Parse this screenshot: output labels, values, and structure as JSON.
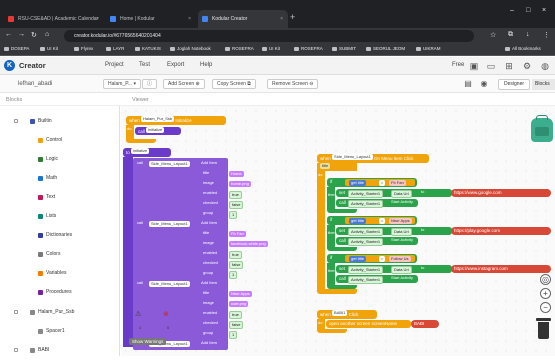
{
  "browser": {
    "tabs": [
      {
        "label": "RSU-CSE&AD | Academic Calendar"
      },
      {
        "label": "Home | Kodular"
      },
      {
        "label": "Kodular Creator"
      }
    ],
    "url": "creator.kodular.io/#6776565640201404",
    "bookmarks": [
      "DOSEPA",
      "UI Kit",
      "Flyrex",
      "LAYR",
      "KATUKIS",
      "Joglah Notebook",
      "ROSEFRA",
      "UI Kit",
      "ROSEFRA",
      "SUBMIT",
      "SEORUL JEOM",
      "UIKRAM",
      "All Bookmarks"
    ]
  },
  "app": {
    "brand": "Creator",
    "menu": [
      "Project",
      "Test",
      "Export",
      "Help"
    ],
    "right_icons": [
      "free-label",
      "gallery-icon",
      "folder-icon",
      "grid-icon",
      "settings-icon",
      "account-icon"
    ],
    "free_label": "Free",
    "project_name": "lefhan_abadi",
    "screen_select": "Halam_P...",
    "add_screen": "Add Screen",
    "copy_screen": "Copy Screen",
    "remove_screen": "Remove Screen",
    "designer_label": "Designer",
    "blocks_label": "Blocks"
  },
  "panels": {
    "blocks_header": "Blocks",
    "viewer_header": "Viewer"
  },
  "sidebar": {
    "items": [
      {
        "label": "Builtin",
        "color": "#3f51b5",
        "indent": 0
      },
      {
        "label": "Control",
        "color": "#f0a30a",
        "indent": 1
      },
      {
        "label": "Logic",
        "color": "#2e7d32",
        "indent": 1
      },
      {
        "label": "Math",
        "color": "#1976d2",
        "indent": 1
      },
      {
        "label": "Text",
        "color": "#c2185b",
        "indent": 1
      },
      {
        "label": "Lists",
        "color": "#00897b",
        "indent": 1
      },
      {
        "label": "Dictionaries",
        "color": "#303f9f",
        "indent": 1
      },
      {
        "label": "Colors",
        "color": "#7a7a7a",
        "indent": 1
      },
      {
        "label": "Variables",
        "color": "#f57c00",
        "indent": 1
      },
      {
        "label": "Procedures",
        "color": "#7b1fa2",
        "indent": 1
      },
      {
        "label": "Halam_Pur_Ssb",
        "color": "#888888",
        "indent": 0
      },
      {
        "label": "Spacer1",
        "color": "#888888",
        "indent": 1
      },
      {
        "label": "BABI",
        "color": "#888888",
        "indent": 0
      }
    ]
  },
  "workspace": {
    "event_top": {
      "when": "when",
      "component": "Halam_Pur_Ssb",
      "event": "Initialize",
      "do": "do",
      "call": "call",
      "proc": "initialize"
    },
    "init_proc": {
      "header": "to",
      "name": "initialize",
      "rows": [
        {
          "label": "call",
          "comp": "Side_Menu_Layout1",
          "method": "Add Item"
        },
        {
          "label": "title",
          "value": "Home"
        },
        {
          "label": "image",
          "value": "home.png"
        },
        {
          "label": "enabled",
          "value": "true"
        },
        {
          "label": "checked",
          "value": "false"
        },
        {
          "label": "group",
          "value": "1"
        },
        {
          "label": "call",
          "comp": "Side_Menu_Layout1",
          "method": "Add Item"
        },
        {
          "label": "title",
          "value": "Fb Fan"
        },
        {
          "label": "image",
          "value": "facebook-white.png"
        },
        {
          "label": "enabled",
          "value": "true"
        },
        {
          "label": "checked",
          "value": "false"
        },
        {
          "label": "group",
          "value": "1"
        },
        {
          "label": "call",
          "comp": "Side_Menu_Layout1",
          "method": "Add Item"
        },
        {
          "label": "title",
          "value": "Ntsrr Apps"
        },
        {
          "label": "image",
          "value": "user.png"
        },
        {
          "label": "enabled",
          "value": "true"
        },
        {
          "label": "checked",
          "value": "false"
        },
        {
          "label": "group",
          "value": "1"
        },
        {
          "label": "call",
          "comp": "Side_Menu_Layout1",
          "method": "Add Item"
        }
      ]
    },
    "item_click": {
      "when": "when",
      "comp": "Side_Menu_Layout1",
      "event": "On Menu Item Click",
      "params": "title",
      "do": "do",
      "branches": [
        {
          "if": "if",
          "get": "get",
          "var": "title",
          "op": "=",
          "text": "Fb Fan",
          "then": "then",
          "set": "set",
          "target": "Activity_Starter1",
          "prop": "Data Uri",
          "to": "to",
          "url": "https://www.google.com",
          "call": "call",
          "call_target": "Activity_Starter1",
          "method": "Start Activity"
        },
        {
          "if": "if",
          "get": "get",
          "var": "title",
          "op": "=",
          "text": "Ntsrr Apps",
          "then": "then",
          "set": "set",
          "target": "Activity_Starter1",
          "prop": "Data Uri",
          "to": "to",
          "url": "https://play.google.com",
          "call": "call",
          "call_target": "Activity_Starter1",
          "method": "Start Activity"
        },
        {
          "if": "if",
          "get": "get",
          "var": "title",
          "op": "=",
          "text": "Follow Us",
          "then": "then",
          "set": "set",
          "target": "Activity_Starter1",
          "prop": "Data Uri",
          "to": "to",
          "url": "https://www.instagram.com",
          "call": "call",
          "call_target": "Activity_Starter1",
          "method": "Start Activity"
        }
      ]
    },
    "babi_block": {
      "when": "when",
      "comp": "BABI1",
      "event": "Click",
      "do": "do",
      "action": "open another screen",
      "param": "screenName",
      "value": "BABI"
    },
    "warning_count": "1",
    "error_count": "0",
    "tooltip": "Show Warnings"
  },
  "colors": {
    "accent": "#1565c0",
    "proc": "#6a3bc9",
    "event": "#f0a30a",
    "logic": "#2aa34a"
  }
}
